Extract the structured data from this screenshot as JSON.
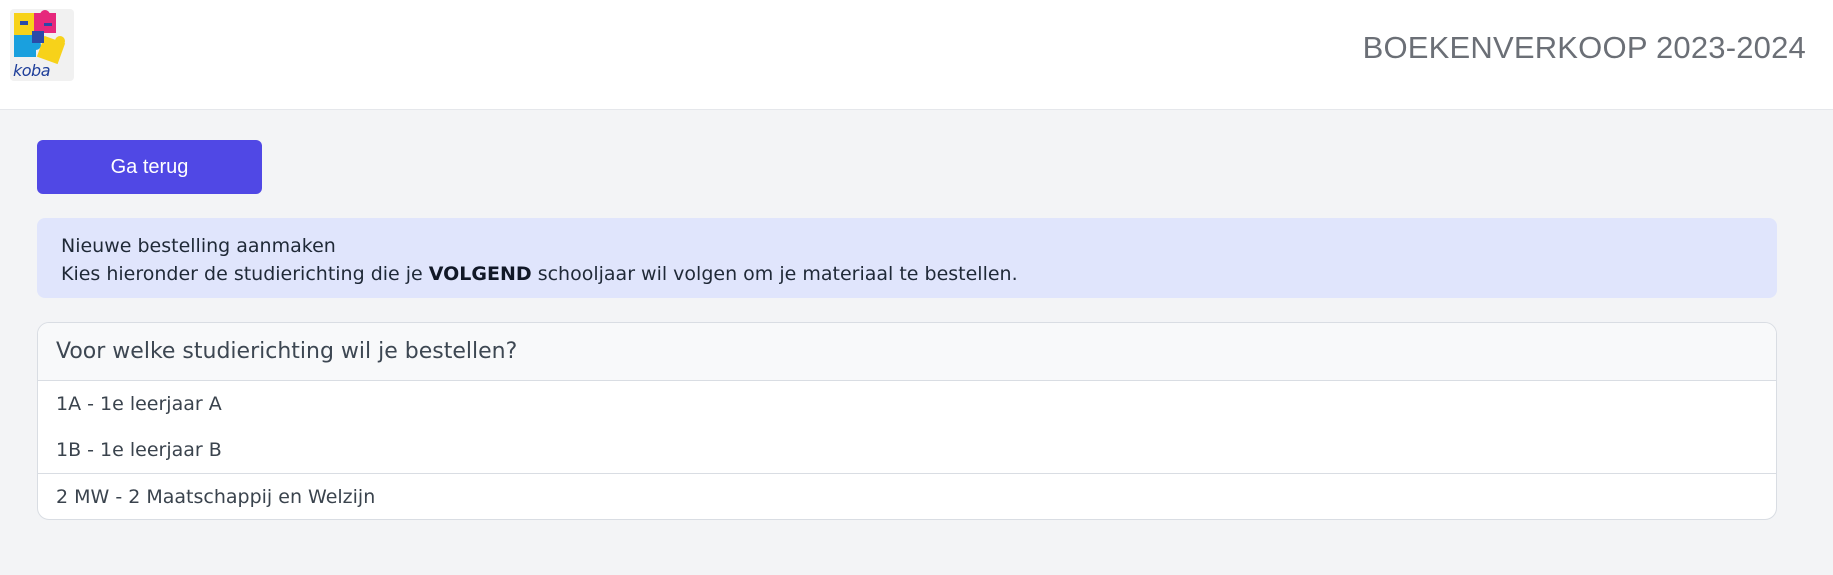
{
  "header": {
    "logo_text": "koba",
    "site_title": "BOEKENVERKOOP 2023-2024"
  },
  "back_button": {
    "label": "Ga terug"
  },
  "alert": {
    "line1": "Nieuwe bestelling aanmaken",
    "line2_before": "Kies hieronder de studierichting die je ",
    "line2_bold": "VOLGEND",
    "line2_after": " schooljaar wil volgen om je materiaal te bestellen."
  },
  "card": {
    "title": "Voor welke studierichting wil je bestellen?",
    "groups": [
      {
        "options": [
          "1A - 1e leerjaar A",
          "1B - 1e leerjaar B"
        ]
      },
      {
        "options": [
          "2 MW - 2 Maatschappij en Welzijn"
        ]
      }
    ]
  },
  "colors": {
    "primary": "#5048e5",
    "alert_bg": "#e0e5fc",
    "page_bg": "#f3f4f6"
  }
}
